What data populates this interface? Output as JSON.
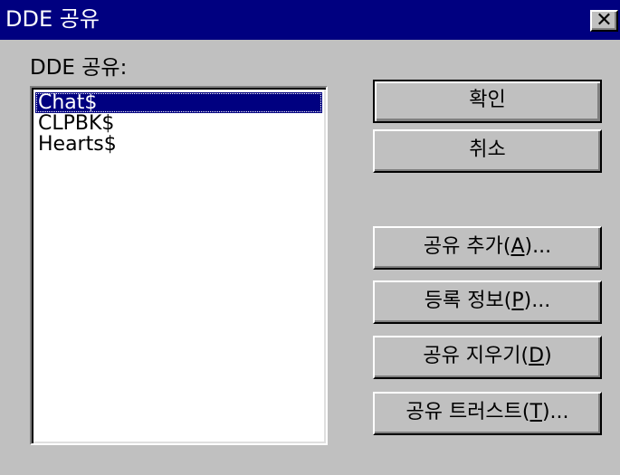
{
  "window": {
    "title": "DDE 공유",
    "close_glyph": "✕"
  },
  "list": {
    "label": "DDE 공유:",
    "items": [
      "Chat$",
      "CLPBK$",
      "Hearts$"
    ],
    "selected_index": 0
  },
  "buttons": {
    "ok": "확인",
    "cancel": "취소",
    "add_share": {
      "pre": "공유 추가(",
      "key": "A",
      "post": ")..."
    },
    "properties": {
      "pre": "등록 정보(",
      "key": "P",
      "post": ")..."
    },
    "delete_share": {
      "pre": "공유 지우기(",
      "key": "D",
      "post": ")"
    },
    "trust_share": {
      "pre": "공유 트러스트(",
      "key": "T",
      "post": ")..."
    }
  },
  "colors": {
    "title_bar": "#000080",
    "face": "#c0c0c0",
    "selection": "#000080"
  }
}
